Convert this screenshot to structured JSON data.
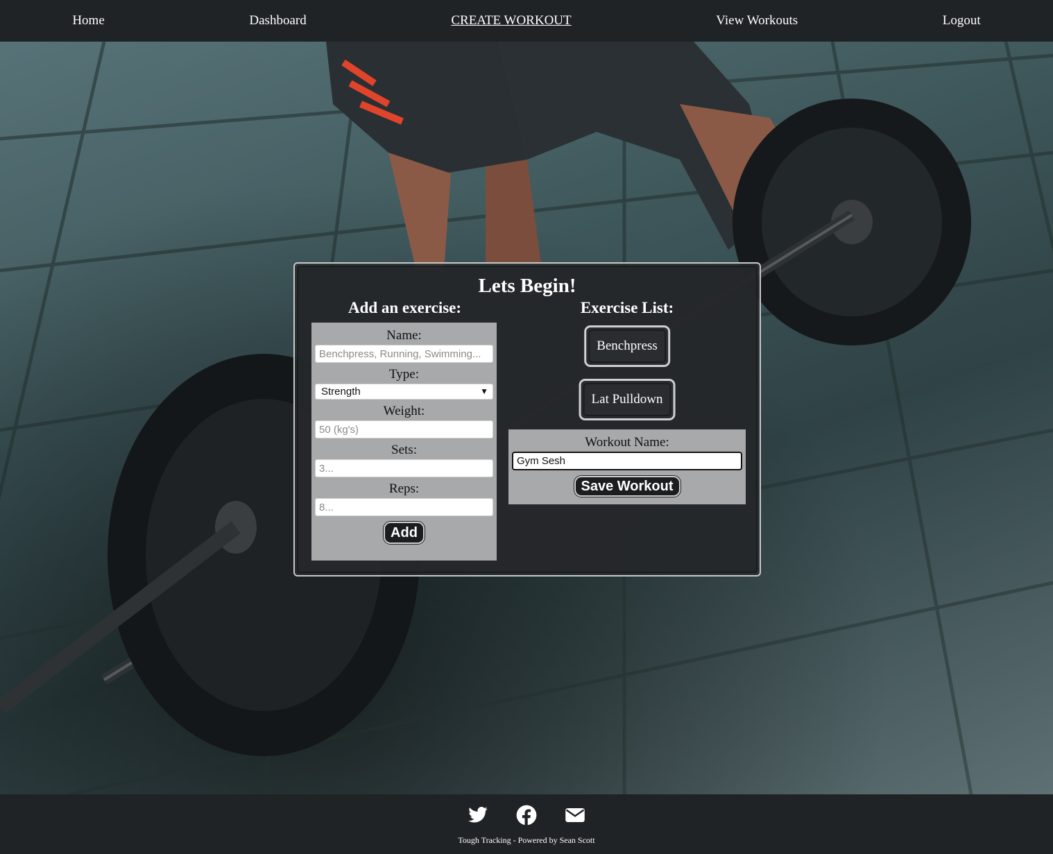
{
  "nav": {
    "items": [
      {
        "label": "Home"
      },
      {
        "label": "Dashboard"
      },
      {
        "label": "CREATE WORKOUT"
      },
      {
        "label": "View Workouts"
      },
      {
        "label": "Logout"
      }
    ]
  },
  "panel": {
    "title": "Lets Begin!",
    "add_heading": "Add an exercise:",
    "list_heading": "Exercise List:"
  },
  "form": {
    "name_label": "Name:",
    "name_placeholder": "Benchpress, Running, Swimming...",
    "type_label": "Type:",
    "type_value": "Strength",
    "weight_label": "Weight:",
    "weight_placeholder": "50 (kg's)",
    "sets_label": "Sets:",
    "sets_placeholder": "3...",
    "reps_label": "Reps:",
    "reps_placeholder": "8...",
    "add_label": "Add"
  },
  "exercises": [
    {
      "label": "Benchpress"
    },
    {
      "label": "Lat Pulldown"
    }
  ],
  "save": {
    "name_label": "Workout Name:",
    "name_value": "Gym Sesh",
    "button_label": "Save Workout"
  },
  "footer": {
    "text": "Tough Tracking - Powered by Sean Scott",
    "icons": [
      "twitter-icon",
      "facebook-icon",
      "email-icon"
    ]
  },
  "colors": {
    "bar_bg": "#202326",
    "panel_bg": "#2b2e31",
    "form_bg": "#a8a9ab"
  }
}
